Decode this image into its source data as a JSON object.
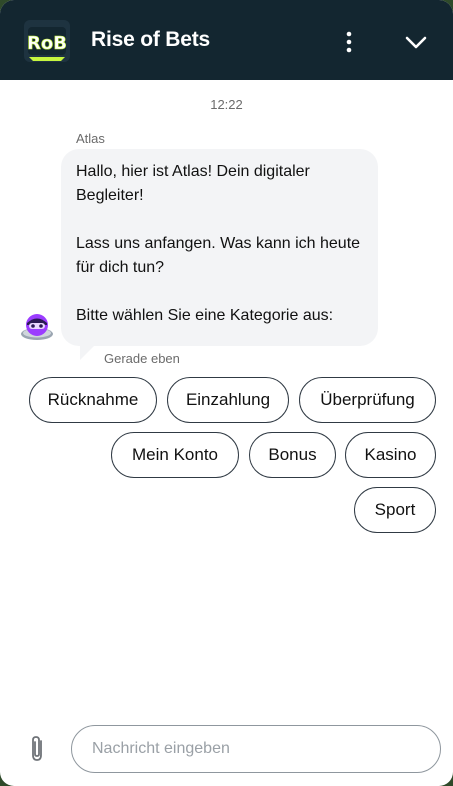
{
  "header": {
    "logo_text": "RoB",
    "title": "Rise of Bets",
    "menu_icon": "kebab-menu-icon",
    "collapse_icon": "chevron-down-icon"
  },
  "chat": {
    "timestamp": "12:22",
    "message": {
      "sender": "Atlas",
      "paragraphs": [
        "Hallo, hier ist Atlas! Dein digitaler Begleiter!",
        "Lass uns anfangen. Was kann ich heute für dich tun?",
        "Bitte wählen Sie eine Kategorie aus:"
      ],
      "status": "Gerade eben"
    },
    "quick_replies": [
      "Rücknahme",
      "Einzahlung",
      "Überprüfung",
      "Mein Konto",
      "Bonus",
      "Kasino",
      "Sport"
    ]
  },
  "composer": {
    "placeholder": "Nachricht eingeben",
    "attach_icon": "paperclip-icon"
  },
  "colors": {
    "header_bg": "#132630",
    "bubble_bg": "#f3f4f6",
    "logo_accent": "#c6f53f",
    "avatar_purple": "#9b3dff"
  }
}
